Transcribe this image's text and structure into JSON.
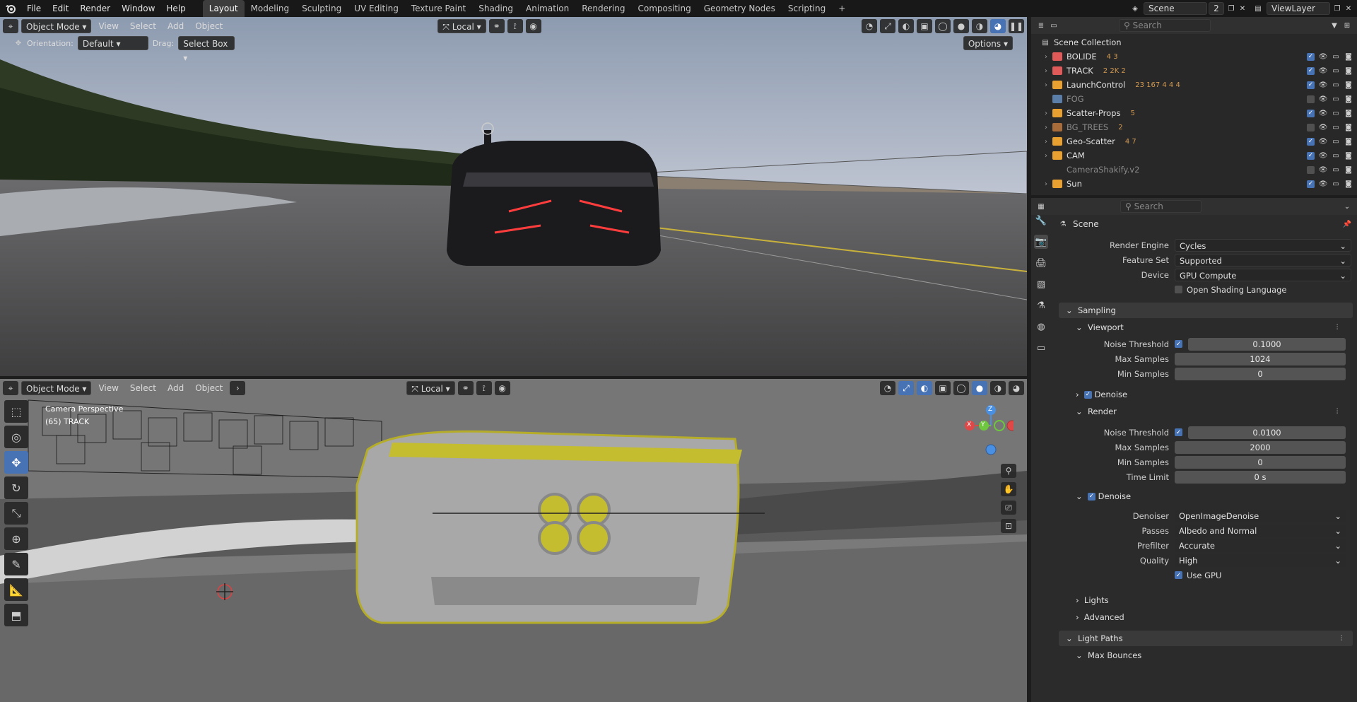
{
  "menu": [
    "File",
    "Edit",
    "Render",
    "Window",
    "Help"
  ],
  "workspaces": [
    "Layout",
    "Modeling",
    "Sculpting",
    "UV Editing",
    "Texture Paint",
    "Shading",
    "Animation",
    "Rendering",
    "Compositing",
    "Geometry Nodes",
    "Scripting"
  ],
  "active_workspace": "Layout",
  "scene_name": "Scene",
  "scene_count": "2",
  "view_layer": "ViewLayer",
  "top_viewport": {
    "mode": "Object Mode",
    "menus": [
      "View",
      "Select",
      "Add",
      "Object"
    ],
    "orientation_label": "Orientation:",
    "orientation_value": "Default",
    "drag_label": "Drag:",
    "drag_value": "Select Box",
    "transform_space": "Local",
    "options": "Options"
  },
  "bottom_viewport": {
    "mode": "Object Mode",
    "menus": [
      "View",
      "Select",
      "Add",
      "Object"
    ],
    "transform_space": "Local",
    "camera_label": "Camera Perspective",
    "object_label": "(65) TRACK",
    "gizmo": {
      "z": "Z",
      "y": "Y",
      "x": "X"
    }
  },
  "outliner": {
    "search_placeholder": "Search",
    "root": "Scene Collection",
    "items": [
      {
        "name": "BOLIDE",
        "color": "#e05a5a",
        "counts": "4 3",
        "dim": false
      },
      {
        "name": "TRACK",
        "color": "#e05a5a",
        "counts": "2 2K 2",
        "dim": false
      },
      {
        "name": "LaunchControl",
        "color": "#e8a030",
        "counts": "23 167 4 4 4",
        "dim": false
      },
      {
        "name": "FOG",
        "color": "#5a7ea8",
        "counts": "",
        "dim": true
      },
      {
        "name": "Scatter-Props",
        "color": "#e8a030",
        "counts": "5",
        "dim": false
      },
      {
        "name": "BG_TREES",
        "color": "#a86b3a",
        "counts": "2",
        "dim": true
      },
      {
        "name": "Geo-Scatter",
        "color": "#e8a030",
        "counts": "4 7",
        "dim": false
      },
      {
        "name": "CAM",
        "color": "#e8a030",
        "counts": "",
        "dim": false
      },
      {
        "name": "CameraShakify.v2",
        "color": "",
        "counts": "",
        "dim": true
      },
      {
        "name": "Sun",
        "color": "#e8a030",
        "counts": "",
        "dim": false
      }
    ]
  },
  "properties": {
    "search_placeholder": "Search",
    "context": "Scene",
    "render_engine_label": "Render Engine",
    "render_engine": "Cycles",
    "feature_set_label": "Feature Set",
    "feature_set": "Supported",
    "device_label": "Device",
    "device": "GPU Compute",
    "osl_label": "Open Shading Language",
    "sampling": "Sampling",
    "viewport": "Viewport",
    "noise_threshold_label": "Noise Threshold",
    "vp_noise_threshold": "0.1000",
    "max_samples_label": "Max Samples",
    "vp_max_samples": "1024",
    "min_samples_label": "Min Samples",
    "vp_min_samples": "0",
    "denoise": "Denoise",
    "render": "Render",
    "r_noise_threshold": "0.0100",
    "r_max_samples": "2000",
    "r_min_samples": "0",
    "time_limit_label": "Time Limit",
    "time_limit": "0 s",
    "denoiser_label": "Denoiser",
    "denoiser": "OpenImageDenoise",
    "passes_label": "Passes",
    "passes": "Albedo and Normal",
    "prefilter_label": "Prefilter",
    "prefilter": "Accurate",
    "quality_label": "Quality",
    "quality": "High",
    "use_gpu": "Use GPU",
    "lights": "Lights",
    "advanced": "Advanced",
    "light_paths": "Light Paths",
    "max_bounces": "Max Bounces"
  }
}
